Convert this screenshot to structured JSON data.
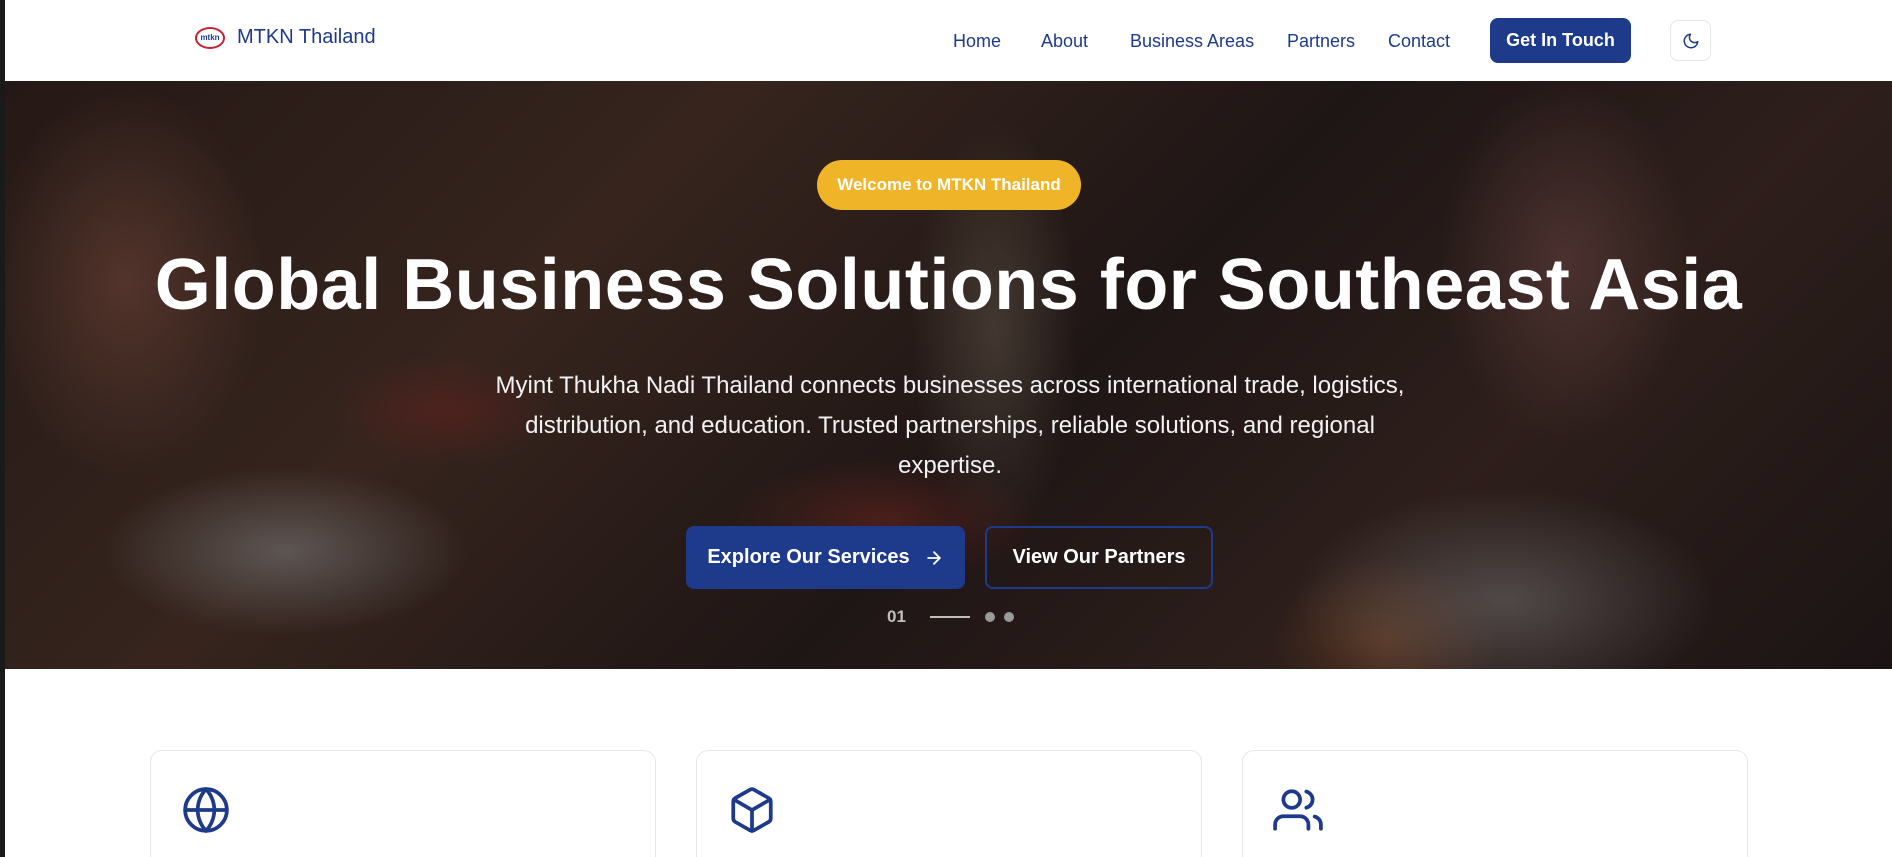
{
  "brand": {
    "logo_text": "mtkn",
    "name": "MTKN Thailand"
  },
  "nav": {
    "links": [
      "Home",
      "About",
      "Business Areas",
      "Partners",
      "Contact"
    ],
    "cta_label": "Get In Touch",
    "theme_toggle_icon": "moon-icon"
  },
  "hero": {
    "badge": "Welcome to MTKN Thailand",
    "title": "Global Business Solutions for Southeast Asia",
    "subtitle": "Myint Thukha Nadi Thailand connects businesses across international trade, logistics, distribution, and education. Trusted partnerships, reliable solutions, and regional expertise.",
    "primary_button": "Explore Our Services",
    "secondary_button": "View Our Partners",
    "slide_number": "01",
    "slide_count": 3
  },
  "cards": [
    {
      "icon": "globe-icon"
    },
    {
      "icon": "package-icon"
    },
    {
      "icon": "users-icon"
    }
  ],
  "colors": {
    "primary": "#1e3a8a",
    "accent": "#f0b429",
    "logo_red": "#c8202f"
  }
}
